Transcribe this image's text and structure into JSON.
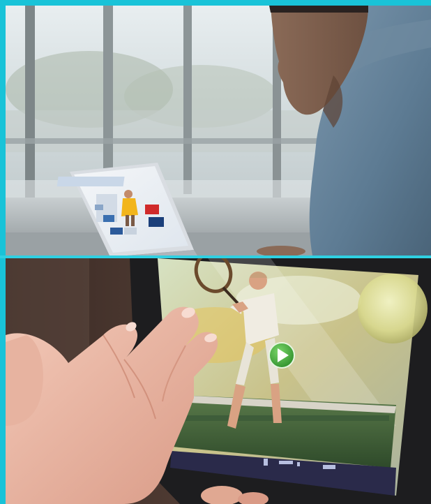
{
  "scene": {
    "top_panel": {
      "subject": "man-using-laptop",
      "laptop_screen": "web-page-with-tennis-player-and-tiles"
    },
    "bottom_panel": {
      "subject": "hand-gesturing-at-tablet",
      "tablet_screen": "tennis-player-with-play-button"
    }
  },
  "colors": {
    "frame": "#19c3d8",
    "divider": "#2fd0e2",
    "play_button": "#3fb03a",
    "player_shirt": "#f2b51b",
    "tablet_control_bar": "#2a2a4a"
  },
  "icons": {
    "play": "play-icon"
  }
}
